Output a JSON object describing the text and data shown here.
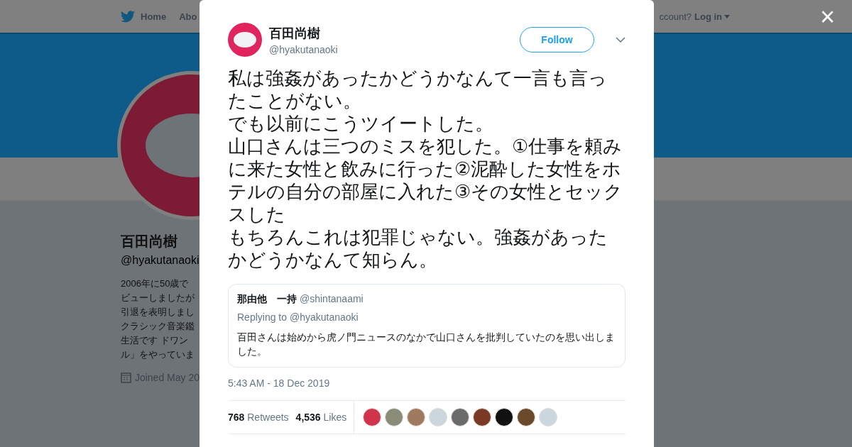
{
  "background": {
    "nav": {
      "home": "Home",
      "about": "Abo",
      "account": "ccount?",
      "login": "Log in"
    },
    "profile": {
      "name": "百田尚樹",
      "handle": "@hyakutanaoki",
      "bio": [
        "2006年に50歳で",
        "ビューしましたが",
        "引退を表明しまし",
        "クラシック音楽鑑",
        "生活です ドワン",
        "ル」をやっていま"
      ],
      "joined": "Joined May 20"
    }
  },
  "close": "×",
  "tweet": {
    "name": "百田尚樹",
    "handle": "@hyakutanaoki",
    "follow": "Follow",
    "paragraphs": [
      "私は強姦があったかどうかなんて一言も言ったことがない。",
      "でも以前にこうツイートした。",
      "山口さんは三つのミスを犯した。①仕事を頼みに来た女性と飲みに行った②泥酔した女性をホテルの自分の部屋に入れた③その女性とセックスした",
      "もちろんこれは犯罪じゃない。強姦があったかどうかなんて知らん。"
    ],
    "quote": {
      "name": "那由他　一持",
      "handle": "@shintanaami",
      "replying": "Replying to @hyakutanaoki",
      "text": "百田さんは始めから虎ノ門ニュースのなかで山口さんを批判していたのを思い出しました。"
    },
    "time": "5:43 AM - 18 Dec 2019",
    "stats": [
      {
        "count": "768",
        "label": "Retweets"
      },
      {
        "count": "4,536",
        "label": "Likes"
      }
    ],
    "likers": [
      {
        "color": "#d0344d"
      },
      {
        "color": "#8a8c78"
      },
      {
        "color": "#a07a5e"
      },
      {
        "color": "#ccd6dd"
      },
      {
        "color": "#6b6b6b"
      },
      {
        "color": "#7a3a24"
      },
      {
        "color": "#111111"
      },
      {
        "color": "#6a4a2a"
      },
      {
        "color": "#ccd6dd"
      }
    ]
  }
}
